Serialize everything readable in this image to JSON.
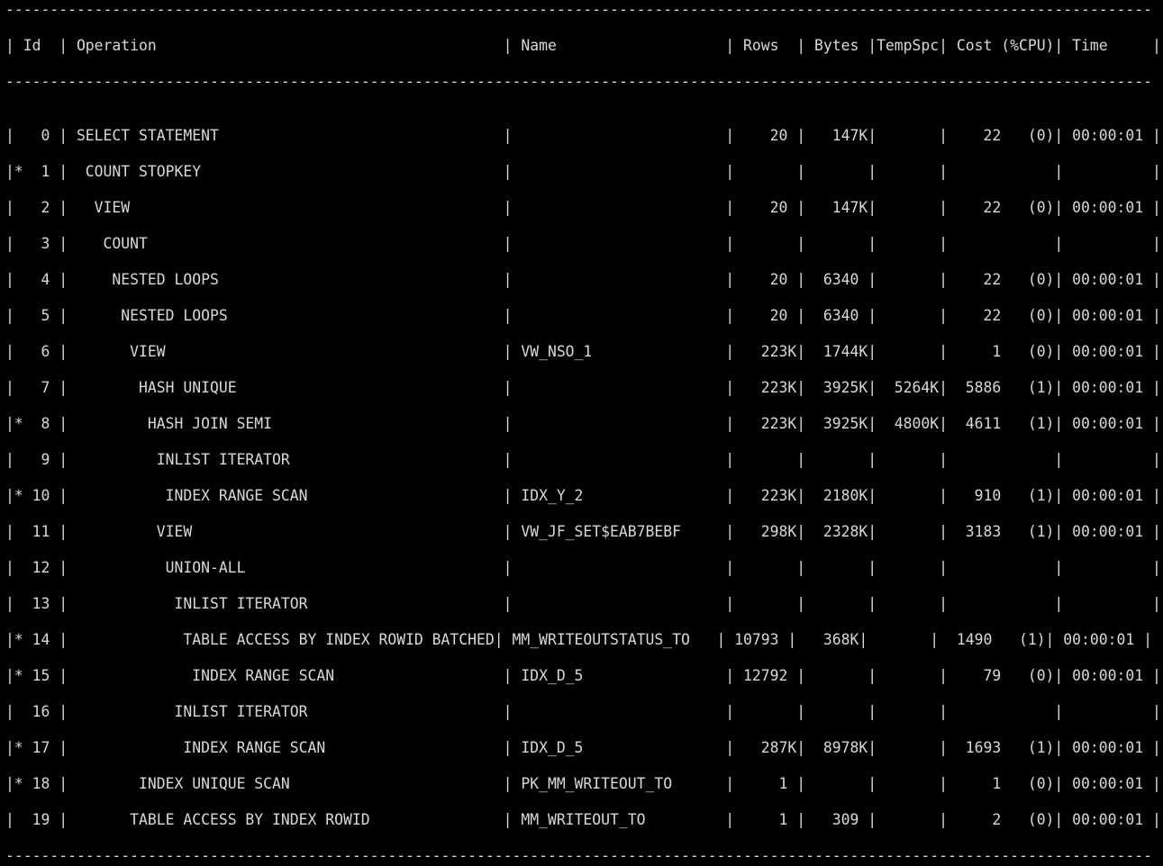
{
  "terminal": {
    "lines": [
      "---------------------------------------------------------------------------------------------------------------------------------",
      "| Id  | Operation                                       | Name                   | Rows  | Bytes |TempSpc| Cost (%CPU)| Time     |",
      "---------------------------------------------------------------------------------------------------------------------------------",
      "|   0 | SELECT STATEMENT                                |                        |    20 |   147K|       |    22   (0)| 00:00:01 |",
      "|*  1 |  COUNT STOPKEY                                  |                        |       |       |       |            |          |",
      "|   2 |   VIEW                                          |                        |    20 |   147K|       |    22   (0)| 00:00:01 |",
      "|   3 |    COUNT                                        |                        |       |       |       |            |          |",
      "|   4 |     NESTED LOOPS                                |                        |    20 |  6340 |       |    22   (0)| 00:00:01 |",
      "|   5 |      NESTED LOOPS                               |                        |    20 |  6340 |       |    22   (0)| 00:00:01 |",
      "|   6 |       VIEW                                      | VW_NSO_1               |   223K|  1744K|       |     1   (0)| 00:00:01 |",
      "|   7 |        HASH UNIQUE                              |                        |   223K|  3925K|  5264K|  5886   (1)| 00:00:01 |",
      "|*  8 |         HASH JOIN SEMI                          |                        |   223K|  3925K|  4800K|  4611   (1)| 00:00:01 |",
      "|   9 |          INLIST ITERATOR                        |                        |       |       |       |            |          |",
      "|* 10 |           INDEX RANGE SCAN                      | IDX_Y_2                |   223K|  2180K|       |   910   (1)| 00:00:01 |",
      "|  11 |          VIEW                                   | VW_JF_SET$EAB7BEBF     |   298K|  2328K|       |  3183   (1)| 00:00:01 |",
      "|  12 |           UNION-ALL                             |                        |       |       |       |            |          |",
      "|  13 |            INLIST ITERATOR                      |                        |       |       |       |            |          |",
      "|* 14 |             TABLE ACCESS BY INDEX ROWID BATCHED| MM_WRITEOUTSTATUS_TO   | 10793 |   368K|       |  1490   (1)| 00:00:01 |",
      "|* 15 |              INDEX RANGE SCAN                   | IDX_D_5                | 12792 |       |       |    79   (0)| 00:00:01 |",
      "|  16 |            INLIST ITERATOR                      |                        |       |       |       |            |          |",
      "|* 17 |             INDEX RANGE SCAN                    | IDX_D_5                |   287K|  8978K|       |  1693   (1)| 00:00:01 |",
      "|* 18 |        INDEX UNIQUE SCAN                        | PK_MM_WRITEOUT_TO      |     1 |       |       |     1   (0)| 00:00:01 |",
      "|  19 |       TABLE ACCESS BY INDEX ROWID               | MM_WRITEOUT_TO         |     1 |   309 |       |     2   (0)| 00:00:01 |",
      "---------------------------------------------------------------------------------------------------------------------------------"
    ]
  }
}
